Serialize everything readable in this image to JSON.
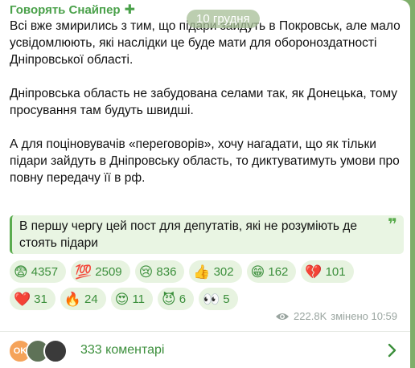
{
  "channel": {
    "author": "Говорять Снайпер",
    "date": "10 грудня"
  },
  "post": {
    "paragraphs": [
      "Всі вже змирились з тим, що підари зайдуть в Покровськ, але мало усвідомлюють, які наслідки це буде мати для обороноздатності Дніпровської області.",
      "Дніпровська область не забудована селами так, як Донецька, тому просування там будуть швидші.",
      "А для поціновувачів «переговорів», хочу нагадати, що як тільки підари зайдуть в Дніпровську область, то диктуватимуть умови про повну передачу її в рф."
    ],
    "quote": "В першу чергу цей пост для депутатів, які не розуміють де стоять підари"
  },
  "reactions": [
    {
      "emoji": "😨",
      "count": "4357"
    },
    {
      "emoji": "💯",
      "count": "2509"
    },
    {
      "emoji": "😢",
      "count": "836"
    },
    {
      "emoji": "👍",
      "count": "302"
    },
    {
      "emoji": "😁",
      "count": "162"
    },
    {
      "emoji": "💔",
      "count": "101"
    },
    {
      "emoji": "❤️",
      "count": "31"
    },
    {
      "emoji": "🔥",
      "count": "24"
    },
    {
      "emoji": "😍",
      "count": "11"
    },
    {
      "emoji": "😈",
      "count": "6"
    },
    {
      "emoji": "👀",
      "count": "5"
    }
  ],
  "meta": {
    "views": "222.8K",
    "edited": "змінено 10:59"
  },
  "comments": {
    "label": "333 коментарі",
    "avatar_initials": "OK"
  },
  "colors": {
    "accent": "#3c8f3c",
    "background": "#7fae6a"
  }
}
